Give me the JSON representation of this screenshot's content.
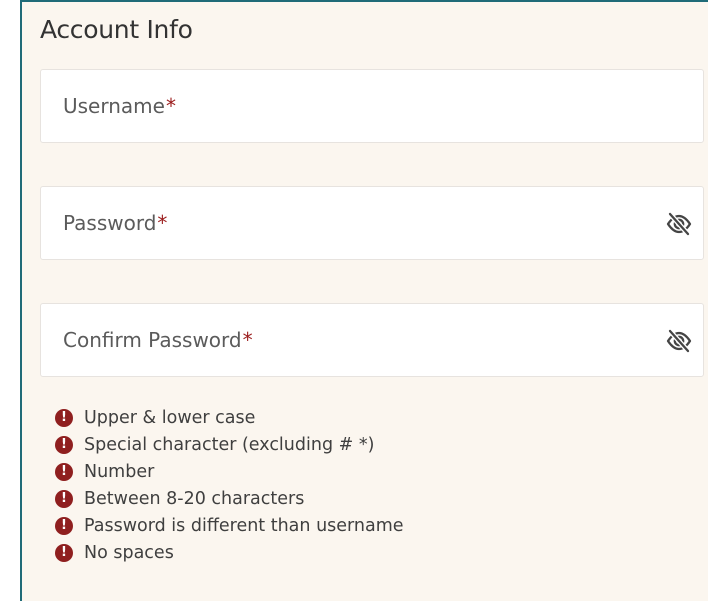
{
  "section": {
    "title": "Account Info"
  },
  "fields": {
    "username": {
      "label": "Username",
      "required_mark": "*"
    },
    "password": {
      "label": "Password",
      "required_mark": "*",
      "toggle_icon": "eye-slash-icon"
    },
    "confirm_password": {
      "label": "Confirm Password",
      "required_mark": "*",
      "toggle_icon": "eye-slash-icon"
    }
  },
  "password_requirements": {
    "status_icon": "exclamation-circle-icon",
    "status_icon_glyph": "!",
    "items": [
      "Upper & lower case",
      "Special character (excluding # *)",
      "Number",
      "Between 8-20 characters",
      "Password is different than username",
      "No spaces"
    ]
  },
  "colors": {
    "panel_background": "#fbf6ef",
    "panel_border": "#1f6b78",
    "required_asterisk": "#9b1c1c",
    "requirement_icon": "#8f1f1f"
  }
}
